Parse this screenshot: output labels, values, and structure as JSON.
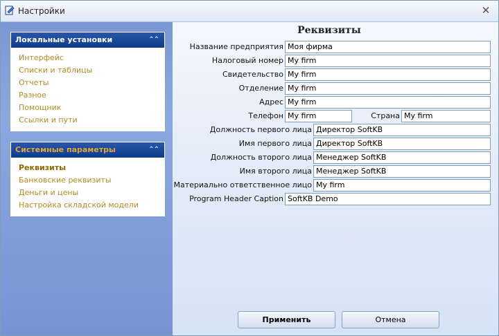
{
  "window": {
    "title": "Настройки"
  },
  "sidebar": {
    "groups": [
      {
        "header": "Локальные установки",
        "items": [
          "Интерфейс",
          "Списки и таблицы",
          "Отчеты",
          "Разное",
          "Помощник",
          "Ссылки и пути"
        ]
      },
      {
        "header": "Системные параметры",
        "items": [
          "Реквизиты",
          "Банковские реквизиты",
          "Деньги и цены",
          "Настройка складской модели"
        ]
      }
    ]
  },
  "main": {
    "title": "Реквизиты",
    "fields": {
      "company_name": {
        "label": "Название предприятия",
        "value": "Моя фирма"
      },
      "tax_number": {
        "label": "Налоговый номер",
        "value": "My firm"
      },
      "certificate": {
        "label": "Свидетельство",
        "value": "My firm"
      },
      "department": {
        "label": "Отделение",
        "value": "My firm"
      },
      "address": {
        "label": "Адрес",
        "value": "My firm"
      },
      "phone": {
        "label": "Телефон",
        "value": "My firm"
      },
      "country": {
        "label": "Страна",
        "value": "My firm"
      },
      "first_person_position": {
        "label": "Должность первого лица",
        "value": "Директор SoftKB"
      },
      "first_person_name": {
        "label": "Имя первого лица",
        "value": "Директор SoftKB"
      },
      "second_person_position": {
        "label": "Должность второго лица",
        "value": "Менеджер SoftKB"
      },
      "second_person_name": {
        "label": "Имя второго лица",
        "value": "Менеджер SoftKB"
      },
      "responsible_person": {
        "label": "Материально ответственное лицо",
        "value": "My firm"
      },
      "program_header": {
        "label": "Program Header Caption",
        "value": "SoftKB Demo"
      }
    },
    "buttons": {
      "apply": "Применить",
      "cancel": "Отмена"
    }
  }
}
